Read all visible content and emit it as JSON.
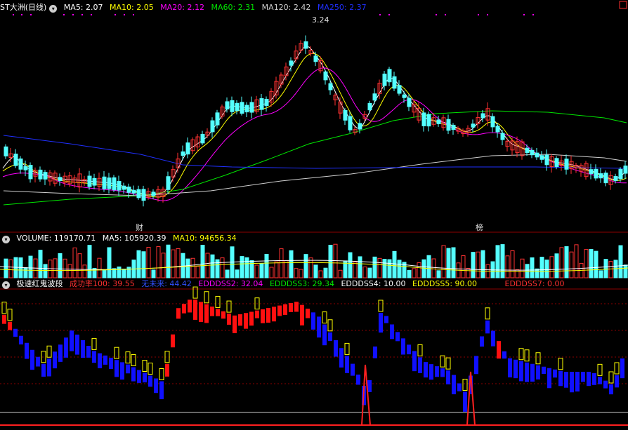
{
  "price_panel": {
    "stock_title": "ST大洲(日线)",
    "ma5": "MA5: 2.07",
    "ma10": "MA10: 2.05",
    "ma20": "MA20: 2.12",
    "ma60": "MA60: 2.31",
    "ma120": "MA120: 2.42",
    "ma250": "MA250: 2.37",
    "high_marker": "3.24",
    "marker_cai": "财",
    "marker_bang": "榜"
  },
  "volume_panel": {
    "volume": "VOLUME: 119170.71",
    "ma5": "MA5: 105920.39",
    "ma10": "MA10: 94656.34"
  },
  "indicator_panel": {
    "name": "极速红鬼波段",
    "success_rate": "成功率100: 39.55",
    "no_future": "无未来: 44.42",
    "eddds2": "EDDDSS2: 32.04",
    "eddds3": "EDDDSS3: 29.34",
    "eddds4": "EDDDSS4: 10.00",
    "eddds5": "EDDDSS5: 90.00",
    "eddds7": "EDDDSS7: 0.00"
  },
  "colors": {
    "up": "#ff3232",
    "down": "#54ffff",
    "ma5": "#ffffff",
    "ma10": "#ffff00",
    "ma20": "#ff00ff",
    "ma60": "#00e600",
    "ma120": "#d0d0d0",
    "ma250": "#2030ff",
    "blue_bar": "#1010ff",
    "red_bar": "#ff1010",
    "grid": "#8b0000"
  },
  "chart_data": {
    "type": "candlestick",
    "series_names": [
      "MA5",
      "MA10",
      "MA20",
      "MA60",
      "MA120",
      "MA250"
    ],
    "high_price": 3.24
  }
}
